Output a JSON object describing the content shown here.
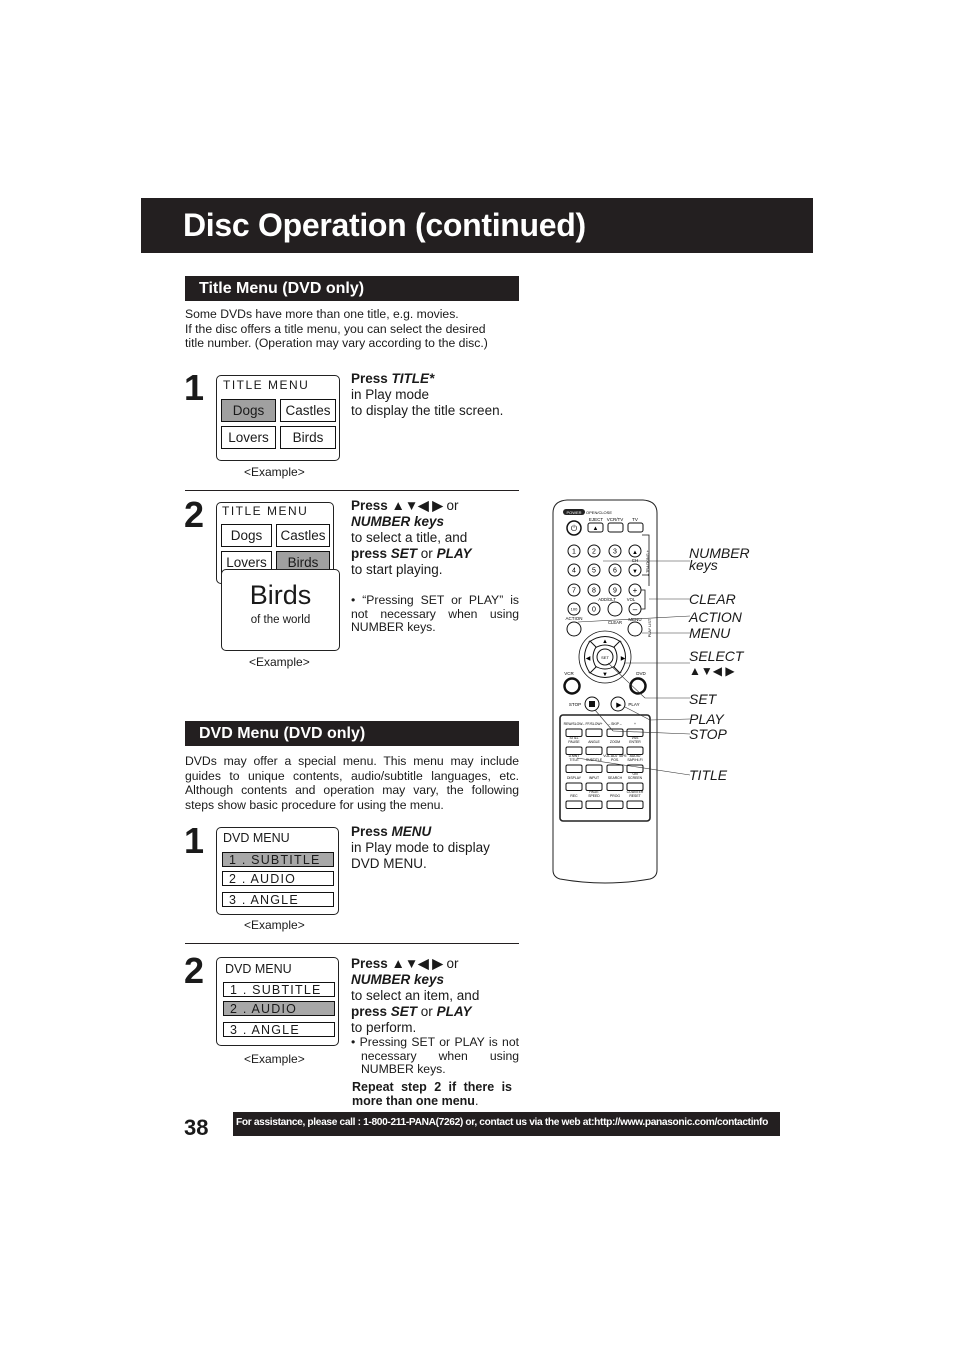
{
  "header": {
    "title": "Disc Operation (continued)"
  },
  "title_menu_section": {
    "heading": "Title Menu (DVD only)",
    "intro": [
      "Some DVDs have more than one title, e.g. movies.",
      "If the disc offers a title menu, you can select the desired",
      "title number. (Operation may vary according to the disc.)"
    ],
    "step1": {
      "number": "1",
      "screen": {
        "title": "TITLE  MENU",
        "cells": [
          {
            "label": "Dogs",
            "selected": true
          },
          {
            "label": "Castles",
            "selected": false
          },
          {
            "label": "Lovers",
            "selected": false
          },
          {
            "label": "Birds",
            "selected": false
          }
        ],
        "caption": "<Example>"
      },
      "instruction": {
        "press": "Press ",
        "key": "TITLE*",
        "line2": "in Play mode",
        "line3": "to display the title screen."
      }
    },
    "step2": {
      "number": "2",
      "screen": {
        "title": "TITLE  MENU",
        "cells": [
          {
            "label": "Dogs",
            "selected": false
          },
          {
            "label": "Castles",
            "selected": false
          },
          {
            "label": "Lovers",
            "selected": false
          },
          {
            "label": "Birds",
            "selected": true
          }
        ],
        "overlay_title": "Birds",
        "overlay_subtitle": "of  the  world",
        "caption": "<Example>"
      },
      "instruction": {
        "press": "Press ",
        "arrows": "▲▼◀ ▶",
        "or": " or",
        "number_keys": "NUMBER keys",
        "line3": "to select a title, and",
        "press2": "press ",
        "set": "SET",
        "or2": " or ",
        "play": "PLAY",
        "line5": "to start playing."
      },
      "note": {
        "bullet": "• “Pressing ",
        "set": "SET",
        "or": " or ",
        "play": "PLAY",
        "rest": "” is not necessary when using ",
        "nk": "NUMBER keys",
        "end": "."
      }
    }
  },
  "dvd_menu_section": {
    "heading": "DVD Menu (DVD only)",
    "intro": "DVDs may offer a special menu. This menu may include guides to unique contents, audio/subtitle languages, etc. Although contents and operation may vary, the following steps show basic procedure for using the menu.",
    "step1": {
      "number": "1",
      "screen": {
        "title": "DVD MENU",
        "items": [
          {
            "label": "1 . SUBTITLE",
            "selected": true
          },
          {
            "label": "2 . AUDIO",
            "selected": false
          },
          {
            "label": "3 . ANGLE",
            "selected": false
          }
        ],
        "caption": "<Example>"
      },
      "instruction": {
        "press": "Press ",
        "key": "MENU",
        "line2": "in Play mode to display",
        "line3": "DVD MENU."
      }
    },
    "step2": {
      "number": "2",
      "screen": {
        "title": "DVD MENU",
        "items": [
          {
            "label": "1 . SUBTITLE",
            "selected": false
          },
          {
            "label": "2 . AUDIO",
            "selected": true
          },
          {
            "label": "3 . ANGLE",
            "selected": false
          }
        ],
        "caption": "<Example>"
      },
      "instruction": {
        "press": "Press ",
        "arrows": "▲▼◀ ▶",
        "or": " or",
        "number_keys": "NUMBER keys",
        "line3": "to select an item, and",
        "press2": "press ",
        "set": "SET",
        "or2": " or ",
        "play": "PLAY",
        "line5": "to perform."
      },
      "note": {
        "bullet": "• Pressing ",
        "set": "SET",
        "or": " or ",
        "play": "PLAY",
        "rest": " is not necessary when using ",
        "nk": "NUMBER keys",
        "end": "."
      },
      "repeat": {
        "bold": "Repeat step 2 if there is more than one menu",
        "end": "."
      }
    }
  },
  "remote": {
    "button_labels": {
      "power": "POWER",
      "open_close": "OPEN/CLOSE",
      "eject": "EJECT",
      "vcr_tv": "VCR/TV",
      "tv": "TV",
      "ch": "CH",
      "tracking": "– TRACKING +",
      "add_dlt": "ADD/DLT",
      "vol": "VOL",
      "clear": "CLEAR",
      "action": "ACTION",
      "menu": "MENU",
      "play_list": "PLAY LIST",
      "set": "SET",
      "vcr": "VCR",
      "dvd": "DVD",
      "stop": "STOP",
      "play": "PLAY",
      "hundred": "100",
      "digits": [
        "1",
        "2",
        "3",
        "4",
        "5",
        "6",
        "7",
        "8",
        "9",
        "0"
      ],
      "bottom_rows": [
        [
          "REW/SLOW–",
          "FF/SLOW+",
          "– SKIP –",
          "+"
        ],
        [
          "STILL PAUSE",
          "ANGLE",
          "ZOOM",
          "VSS ENTER"
        ],
        [
          "D.MNT TITLE",
          "SUBTITLE",
          "VOL.ADJ TAPE POS.",
          "AUDIO SAP/HI-FI"
        ],
        [
          "DISPLAY",
          "INPUT",
          "SEARCH",
          "ON SCREEN"
        ],
        [
          "REC",
          "PAGE SPEED",
          "PROG",
          "COUNTER RESET"
        ]
      ]
    },
    "callouts": {
      "number_keys": [
        "NUMBER",
        "keys"
      ],
      "clear": "CLEAR",
      "action": "ACTION",
      "menu": "MENU",
      "select": "SELECT",
      "select_arrows": "▲▼◀ ▶",
      "set": "SET",
      "play": "PLAY",
      "stop": "STOP",
      "title": "TITLE"
    }
  },
  "footer": {
    "page_number": "38",
    "assistance": "For assistance, please call : 1-800-211-PANA(7262) or, contact us via the web at:http://www.panasonic.com/contactinfo"
  }
}
